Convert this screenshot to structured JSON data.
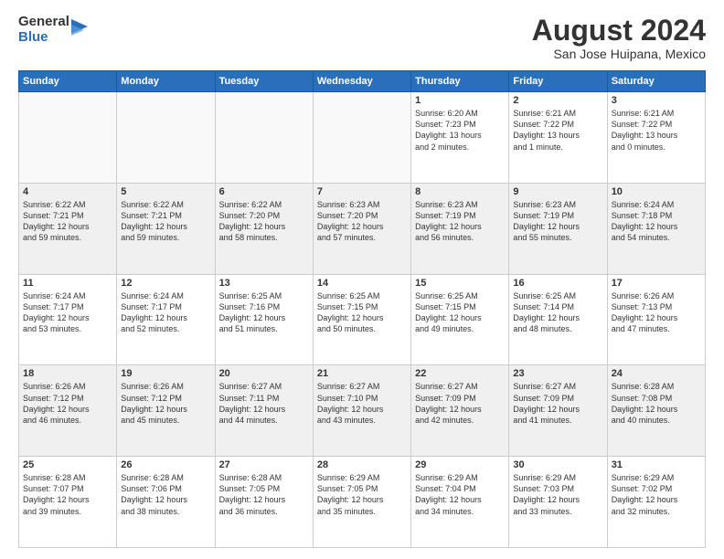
{
  "logo": {
    "general": "General",
    "blue": "Blue"
  },
  "title": "August 2024",
  "location": "San Jose Huipana, Mexico",
  "days_header": [
    "Sunday",
    "Monday",
    "Tuesday",
    "Wednesday",
    "Thursday",
    "Friday",
    "Saturday"
  ],
  "weeks": [
    {
      "alt": false,
      "days": [
        {
          "num": "",
          "info": ""
        },
        {
          "num": "",
          "info": ""
        },
        {
          "num": "",
          "info": ""
        },
        {
          "num": "",
          "info": ""
        },
        {
          "num": "1",
          "info": "Sunrise: 6:20 AM\nSunset: 7:23 PM\nDaylight: 13 hours\nand 2 minutes."
        },
        {
          "num": "2",
          "info": "Sunrise: 6:21 AM\nSunset: 7:22 PM\nDaylight: 13 hours\nand 1 minute."
        },
        {
          "num": "3",
          "info": "Sunrise: 6:21 AM\nSunset: 7:22 PM\nDaylight: 13 hours\nand 0 minutes."
        }
      ]
    },
    {
      "alt": true,
      "days": [
        {
          "num": "4",
          "info": "Sunrise: 6:22 AM\nSunset: 7:21 PM\nDaylight: 12 hours\nand 59 minutes."
        },
        {
          "num": "5",
          "info": "Sunrise: 6:22 AM\nSunset: 7:21 PM\nDaylight: 12 hours\nand 59 minutes."
        },
        {
          "num": "6",
          "info": "Sunrise: 6:22 AM\nSunset: 7:20 PM\nDaylight: 12 hours\nand 58 minutes."
        },
        {
          "num": "7",
          "info": "Sunrise: 6:23 AM\nSunset: 7:20 PM\nDaylight: 12 hours\nand 57 minutes."
        },
        {
          "num": "8",
          "info": "Sunrise: 6:23 AM\nSunset: 7:19 PM\nDaylight: 12 hours\nand 56 minutes."
        },
        {
          "num": "9",
          "info": "Sunrise: 6:23 AM\nSunset: 7:19 PM\nDaylight: 12 hours\nand 55 minutes."
        },
        {
          "num": "10",
          "info": "Sunrise: 6:24 AM\nSunset: 7:18 PM\nDaylight: 12 hours\nand 54 minutes."
        }
      ]
    },
    {
      "alt": false,
      "days": [
        {
          "num": "11",
          "info": "Sunrise: 6:24 AM\nSunset: 7:17 PM\nDaylight: 12 hours\nand 53 minutes."
        },
        {
          "num": "12",
          "info": "Sunrise: 6:24 AM\nSunset: 7:17 PM\nDaylight: 12 hours\nand 52 minutes."
        },
        {
          "num": "13",
          "info": "Sunrise: 6:25 AM\nSunset: 7:16 PM\nDaylight: 12 hours\nand 51 minutes."
        },
        {
          "num": "14",
          "info": "Sunrise: 6:25 AM\nSunset: 7:15 PM\nDaylight: 12 hours\nand 50 minutes."
        },
        {
          "num": "15",
          "info": "Sunrise: 6:25 AM\nSunset: 7:15 PM\nDaylight: 12 hours\nand 49 minutes."
        },
        {
          "num": "16",
          "info": "Sunrise: 6:25 AM\nSunset: 7:14 PM\nDaylight: 12 hours\nand 48 minutes."
        },
        {
          "num": "17",
          "info": "Sunrise: 6:26 AM\nSunset: 7:13 PM\nDaylight: 12 hours\nand 47 minutes."
        }
      ]
    },
    {
      "alt": true,
      "days": [
        {
          "num": "18",
          "info": "Sunrise: 6:26 AM\nSunset: 7:12 PM\nDaylight: 12 hours\nand 46 minutes."
        },
        {
          "num": "19",
          "info": "Sunrise: 6:26 AM\nSunset: 7:12 PM\nDaylight: 12 hours\nand 45 minutes."
        },
        {
          "num": "20",
          "info": "Sunrise: 6:27 AM\nSunset: 7:11 PM\nDaylight: 12 hours\nand 44 minutes."
        },
        {
          "num": "21",
          "info": "Sunrise: 6:27 AM\nSunset: 7:10 PM\nDaylight: 12 hours\nand 43 minutes."
        },
        {
          "num": "22",
          "info": "Sunrise: 6:27 AM\nSunset: 7:09 PM\nDaylight: 12 hours\nand 42 minutes."
        },
        {
          "num": "23",
          "info": "Sunrise: 6:27 AM\nSunset: 7:09 PM\nDaylight: 12 hours\nand 41 minutes."
        },
        {
          "num": "24",
          "info": "Sunrise: 6:28 AM\nSunset: 7:08 PM\nDaylight: 12 hours\nand 40 minutes."
        }
      ]
    },
    {
      "alt": false,
      "days": [
        {
          "num": "25",
          "info": "Sunrise: 6:28 AM\nSunset: 7:07 PM\nDaylight: 12 hours\nand 39 minutes."
        },
        {
          "num": "26",
          "info": "Sunrise: 6:28 AM\nSunset: 7:06 PM\nDaylight: 12 hours\nand 38 minutes."
        },
        {
          "num": "27",
          "info": "Sunrise: 6:28 AM\nSunset: 7:05 PM\nDaylight: 12 hours\nand 36 minutes."
        },
        {
          "num": "28",
          "info": "Sunrise: 6:29 AM\nSunset: 7:05 PM\nDaylight: 12 hours\nand 35 minutes."
        },
        {
          "num": "29",
          "info": "Sunrise: 6:29 AM\nSunset: 7:04 PM\nDaylight: 12 hours\nand 34 minutes."
        },
        {
          "num": "30",
          "info": "Sunrise: 6:29 AM\nSunset: 7:03 PM\nDaylight: 12 hours\nand 33 minutes."
        },
        {
          "num": "31",
          "info": "Sunrise: 6:29 AM\nSunset: 7:02 PM\nDaylight: 12 hours\nand 32 minutes."
        }
      ]
    }
  ]
}
